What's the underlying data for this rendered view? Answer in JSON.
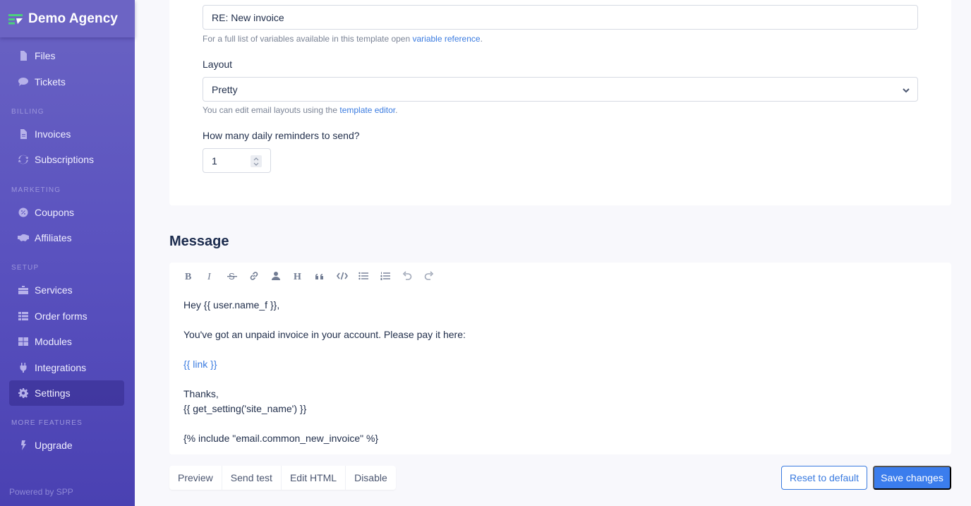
{
  "brand": {
    "name": "Demo Agency",
    "logo_color": "#4cd07d"
  },
  "sidebar": {
    "items_top": [
      {
        "label": "Files",
        "icon": "file-icon"
      },
      {
        "label": "Tickets",
        "icon": "chat-bubble-icon"
      }
    ],
    "sections": [
      {
        "title": "Billing",
        "items": [
          {
            "label": "Invoices",
            "icon": "invoice-icon"
          },
          {
            "label": "Subscriptions",
            "icon": "refresh-icon"
          }
        ]
      },
      {
        "title": "Marketing",
        "items": [
          {
            "label": "Coupons",
            "icon": "coupon-badge-icon"
          },
          {
            "label": "Affiliates",
            "icon": "handshake-icon"
          }
        ]
      },
      {
        "title": "Setup",
        "items": [
          {
            "label": "Services",
            "icon": "toolbox-icon"
          },
          {
            "label": "Order forms",
            "icon": "list-icon"
          },
          {
            "label": "Modules",
            "icon": "grid-icon"
          },
          {
            "label": "Integrations",
            "icon": "plug-icon"
          },
          {
            "label": "Settings",
            "icon": "gear-icon",
            "active": true
          }
        ]
      },
      {
        "title": "More features",
        "items": [
          {
            "label": "Upgrade",
            "icon": "lightning-icon"
          }
        ]
      }
    ],
    "footer": "Powered by SPP"
  },
  "form": {
    "subject_value": "RE: New invoice",
    "subject_help_prefix": "For a full list of variables available in this template open ",
    "subject_help_link": "variable reference",
    "subject_help_suffix": ".",
    "layout_label": "Layout",
    "layout_value": "Pretty",
    "layout_help_prefix": "You can edit email layouts using the ",
    "layout_help_link": "template editor",
    "layout_help_suffix": ".",
    "reminders_label": "How many daily reminders to send?",
    "reminders_value": "1"
  },
  "message": {
    "title": "Message",
    "toolbar": [
      {
        "name": "bold-icon",
        "title": "Bold"
      },
      {
        "name": "italic-icon",
        "title": "Italic"
      },
      {
        "name": "strikethrough-icon",
        "title": "Strikethrough"
      },
      {
        "name": "link-icon",
        "title": "Link"
      },
      {
        "name": "user-icon",
        "title": "Variable"
      },
      {
        "name": "heading-icon",
        "title": "Heading"
      },
      {
        "name": "quote-icon",
        "title": "Quote"
      },
      {
        "name": "code-icon",
        "title": "Code"
      },
      {
        "name": "bullet-list-icon",
        "title": "Bullet list"
      },
      {
        "name": "ordered-list-icon",
        "title": "Ordered list"
      },
      {
        "name": "undo-icon",
        "title": "Undo"
      },
      {
        "name": "redo-icon",
        "title": "Redo"
      }
    ],
    "body": {
      "line1": "Hey {{ user.name_f }},",
      "line2": "You've got an unpaid invoice in your account. Please pay it here:",
      "line3": "{{ link }}",
      "line4": "Thanks,",
      "line5": "{{ get_setting('site_name') }}",
      "line6": "{% include \"email.common_new_invoice\" %}"
    }
  },
  "actions": {
    "preview": "Preview",
    "send_test": "Send test",
    "edit_html": "Edit HTML",
    "disable": "Disable",
    "reset": "Reset to default",
    "save": "Save changes"
  },
  "colors": {
    "sidebar": "#5a52bf",
    "accent": "#3b7ded",
    "link": "#3a7be0"
  }
}
